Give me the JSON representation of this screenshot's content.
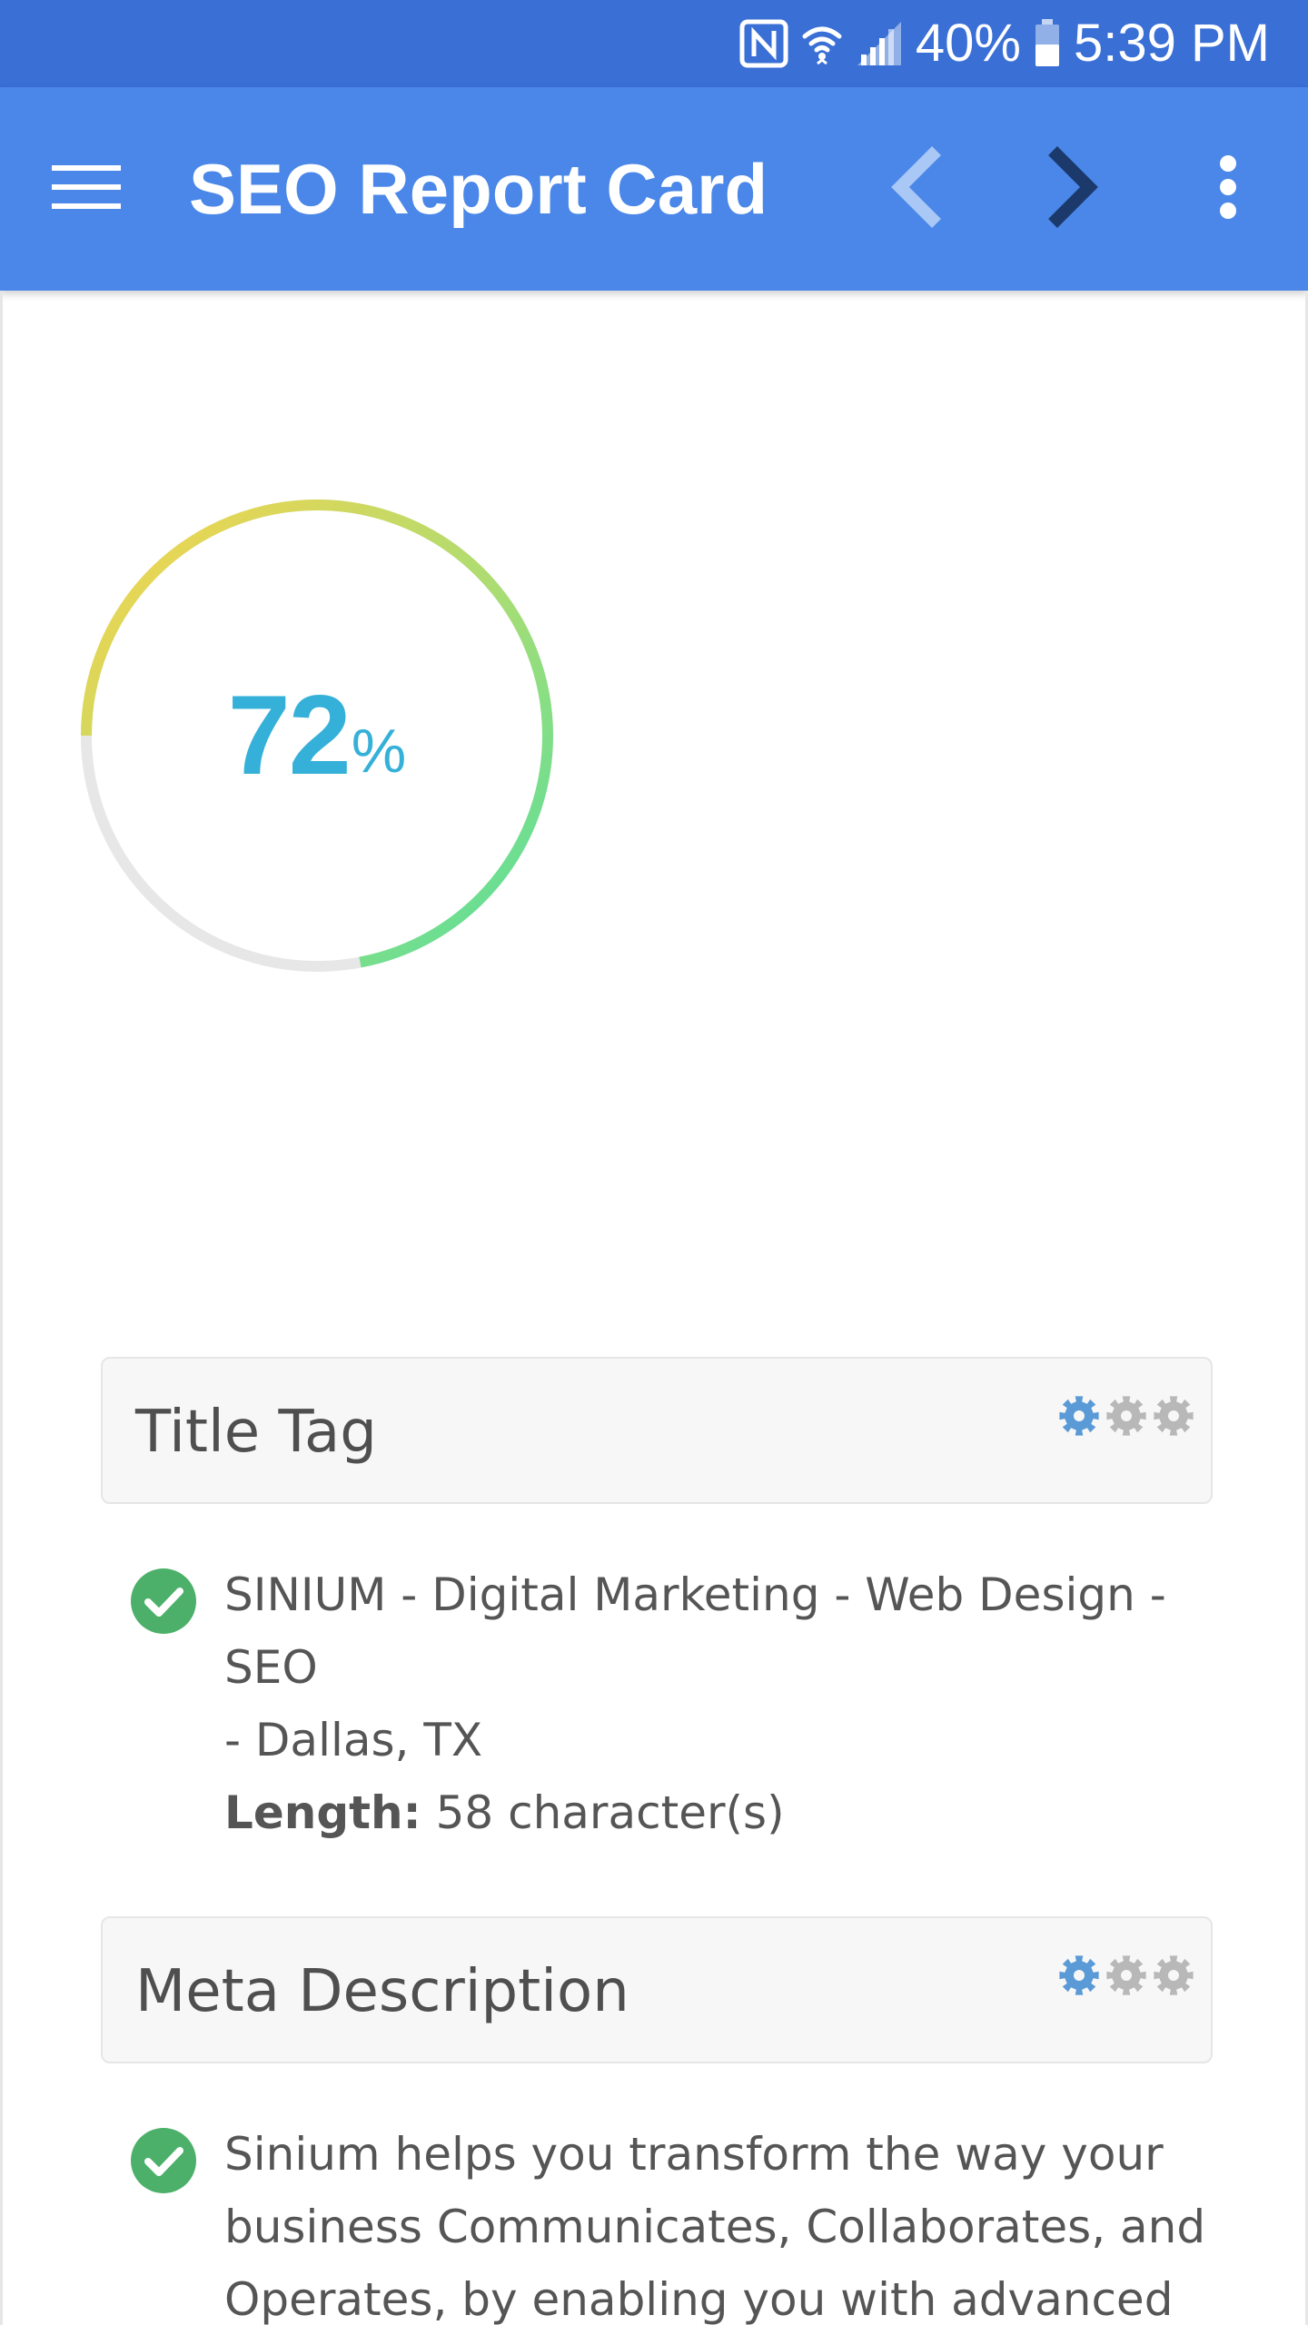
{
  "status_bar": {
    "battery_percent": "40%",
    "time": "5:39 PM",
    "icons": [
      "nfc-icon",
      "wifi-icon",
      "signal-icon",
      "battery-icon"
    ]
  },
  "app_bar": {
    "title": "SEO Report Card",
    "icons": [
      "menu-icon",
      "chevron-left-icon",
      "chevron-right-icon",
      "more-vert-icon"
    ]
  },
  "score": {
    "value": "72",
    "unit": "%",
    "fraction": 0.72,
    "colors": {
      "start": "#50dfa0",
      "mid": "#a8dd74",
      "end": "#fbd34a",
      "track": "#e7e7e7",
      "text": "#35b0d8"
    }
  },
  "sections": [
    {
      "title": "Title Tag",
      "gears": [
        "gear-icon",
        "gear-icon",
        "gear-icon"
      ],
      "result_lines": [
        "SINIUM - Digital Marketing - Web Design - SEO",
        "- Dallas, TX"
      ],
      "length_label": "Length:",
      "length_value": "58 character(s)"
    },
    {
      "title": "Meta Description",
      "gears": [
        "gear-icon",
        "gear-icon",
        "gear-icon"
      ],
      "result_lines": [
        "Sinium helps you transform the way your",
        "business Communicates, Collaborates, and",
        "Operates, by enabling you with advanced"
      ]
    }
  ],
  "colors": {
    "status_bar": "#3a6fd6",
    "app_bar": "#4a87e8",
    "check": "#4cb06a",
    "gear_active": "#5a9ad6",
    "gear_inactive": "#b8b8b8"
  }
}
